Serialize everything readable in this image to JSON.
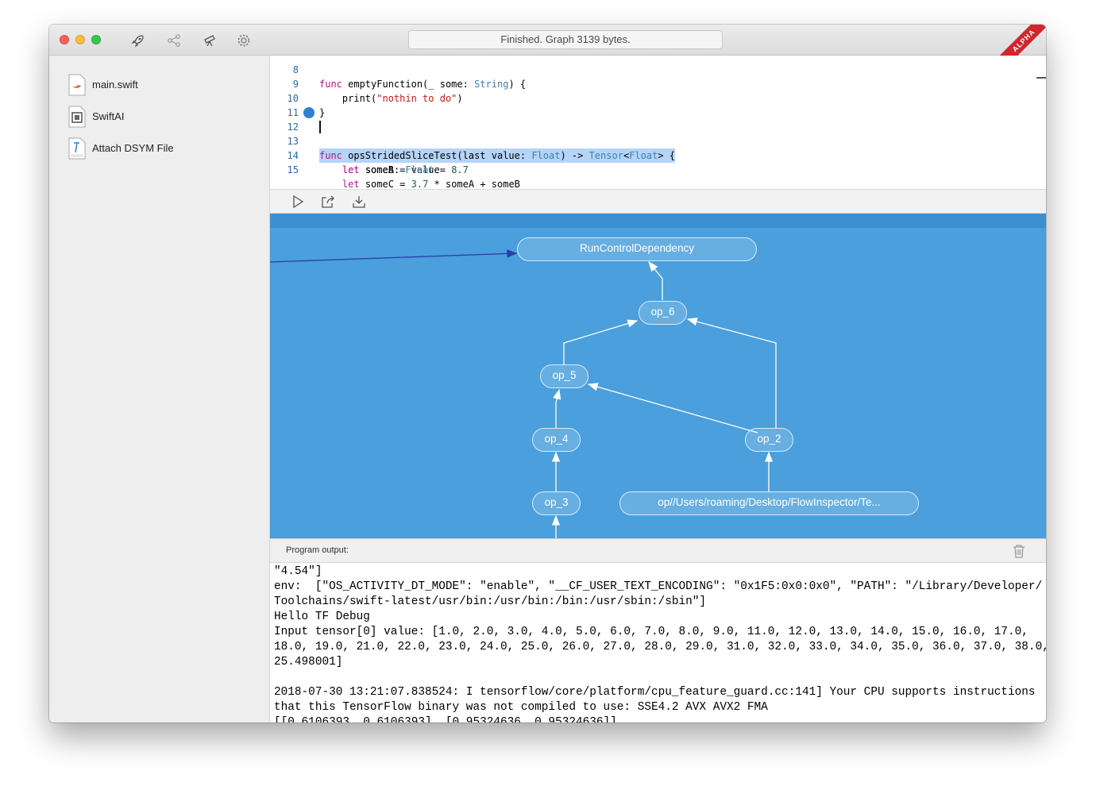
{
  "window": {
    "status": "Finished. Graph 3139 bytes.",
    "badge": "ALPHA"
  },
  "toolbar": {
    "icons": [
      "rocket-icon",
      "share-graph-icon",
      "telescope-icon",
      "gear-icon"
    ]
  },
  "sidebar": {
    "items": [
      {
        "label": "main.swift",
        "icon": "swift-file-icon"
      },
      {
        "label": "SwiftAI",
        "icon": "module-icon"
      },
      {
        "label": "Attach DSYM File",
        "icon": "dsym-file-icon"
      }
    ]
  },
  "editor": {
    "lines": [
      {
        "n": "8",
        "code": "func emptyFunction(_ some: String) {"
      },
      {
        "n": "9",
        "code": "    print(\"nothin to do\")"
      },
      {
        "n": "10",
        "code": "}"
      },
      {
        "n": "11",
        "code": ""
      },
      {
        "n": "12",
        "code": "func opsStridedSliceTest(last value: Float) -> Tensor<Float> {"
      },
      {
        "n": "13",
        "code": "    let someA = value"
      },
      {
        "n": "14",
        "code": "    let someB: Float = 8.7"
      },
      {
        "n": "15",
        "code": "    let someC = 3.7 * someA + someB"
      }
    ],
    "breakpoint_line": "12"
  },
  "editor_toolbar": {
    "icons": [
      "play-icon",
      "export-icon",
      "download-icon"
    ]
  },
  "graph": {
    "nodes": [
      {
        "id": "run",
        "label": "RunControlDependency"
      },
      {
        "id": "op6",
        "label": "op_6"
      },
      {
        "id": "op5",
        "label": "op_5"
      },
      {
        "id": "op4",
        "label": "op_4"
      },
      {
        "id": "op2",
        "label": "op_2"
      },
      {
        "id": "op3",
        "label": "op_3"
      },
      {
        "id": "path",
        "label": "op//Users/roaming/Desktop/FlowInspector/Te..."
      }
    ]
  },
  "output": {
    "title": "Program output:",
    "lines": [
      "\"4.54\"]",
      "env:  [\"OS_ACTIVITY_DT_MODE\": \"enable\", \"__CF_USER_TEXT_ENCODING\": \"0x1F5:0x0:0x0\", \"PATH\": \"/Library/Developer/",
      "Toolchains/swift-latest/usr/bin:/usr/bin:/bin:/usr/sbin:/sbin\"]",
      "Hello TF Debug",
      "Input tensor[0] value: [1.0, 2.0, 3.0, 4.0, 5.0, 6.0, 7.0, 8.0, 9.0, 11.0, 12.0, 13.0, 14.0, 15.0, 16.0, 17.0,",
      "18.0, 19.0, 21.0, 22.0, 23.0, 24.0, 25.0, 26.0, 27.0, 28.0, 29.0, 31.0, 32.0, 33.0, 34.0, 35.0, 36.0, 37.0, 38.0,",
      "25.498001]",
      "",
      "2018-07-30 13:21:07.838524: I tensorflow/core/platform/cpu_feature_guard.cc:141] Your CPU supports instructions",
      "that this TensorFlow binary was not compiled to use: SSE4.2 AVX AVX2 FMA",
      "[[0.6106393, 0.6106393], [0.95324636, 0.95324636]]"
    ]
  },
  "colors": {
    "graph_bg": "#4a9fdc",
    "highlight": "#b6d4f6",
    "breakpoint": "#2f7fd3",
    "alpha_badge": "#d0262d"
  }
}
